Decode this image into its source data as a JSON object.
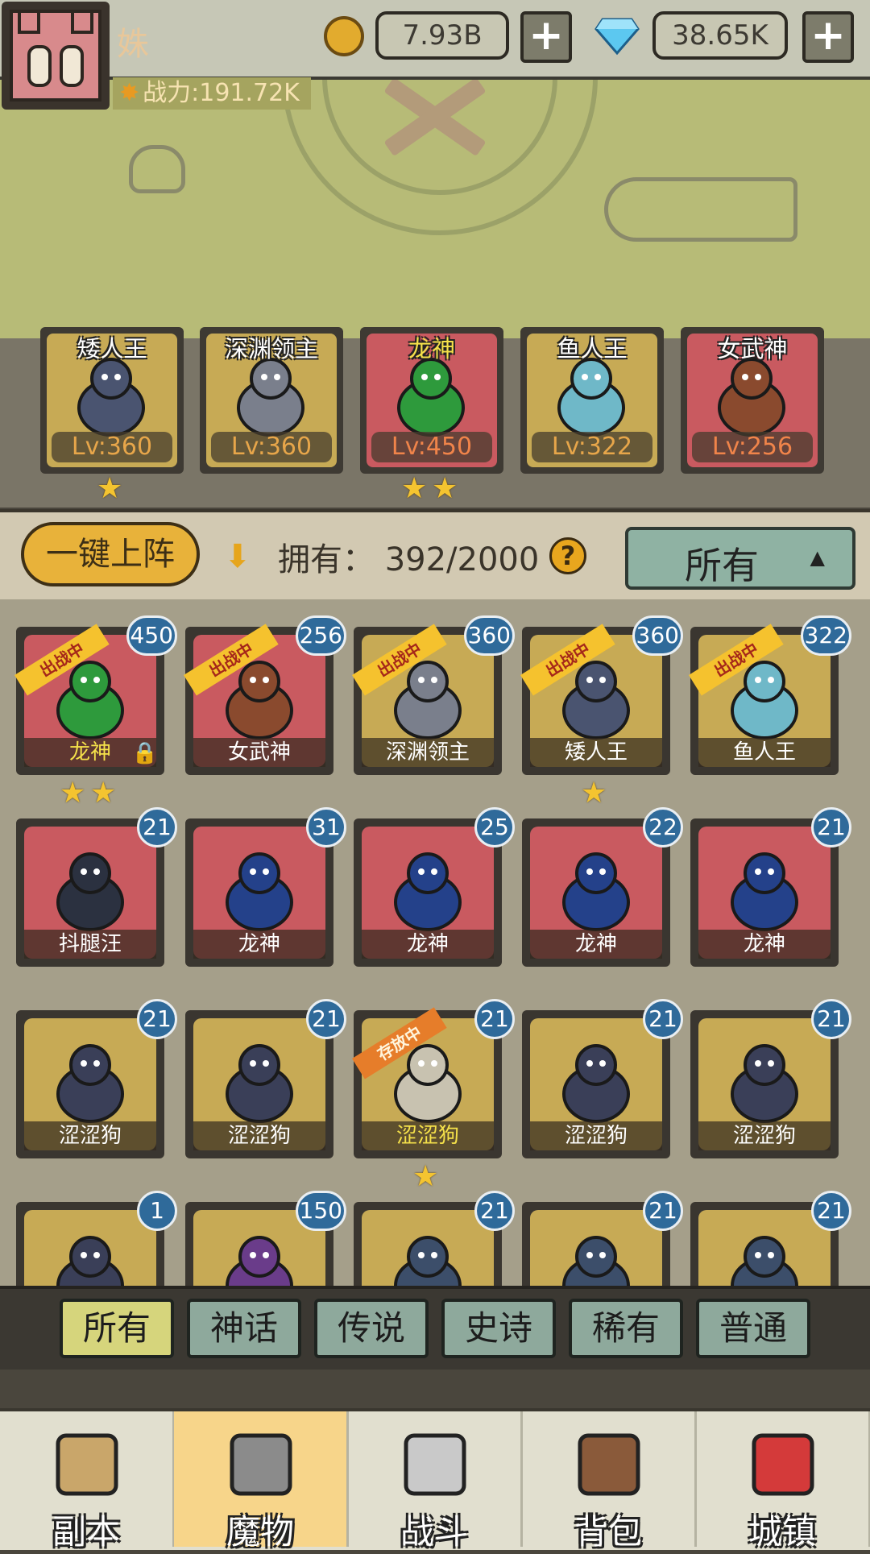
{
  "header": {
    "player_name": "姝",
    "gold": "7.93B",
    "gems": "38.65K",
    "power": "战力:191.72K",
    "plus": "+"
  },
  "formation": [
    {
      "name": "矮人王",
      "level": "Lv:360",
      "stars": 1,
      "bg": "#c7aa55",
      "name_color": "#ffffff",
      "lv_color": "#e7a64a"
    },
    {
      "name": "深渊领主",
      "level": "Lv:360",
      "stars": 0,
      "bg": "#c7aa55",
      "name_color": "#ffffff",
      "lv_color": "#e7a64a"
    },
    {
      "name": "龙神",
      "level": "Lv:450",
      "stars": 2,
      "bg": "#c95a60",
      "name_color": "#f5e14a",
      "lv_color": "#f0844a"
    },
    {
      "name": "鱼人王",
      "level": "Lv:322",
      "stars": 0,
      "bg": "#c7aa55",
      "name_color": "#ffffff",
      "lv_color": "#e7a64a"
    },
    {
      "name": "女武神",
      "level": "Lv:256",
      "stars": 0,
      "bg": "#c95a60",
      "name_color": "#ffffff",
      "lv_color": "#f0844a"
    }
  ],
  "actions": {
    "deploy_label": "一键上阵",
    "owned": "拥有： 392/2000",
    "help": "?",
    "sort_label": "所有"
  },
  "monsters": [
    [
      {
        "name": "龙神",
        "level": "450",
        "bg": "#c95a60",
        "tag": "出战中",
        "stars": 2,
        "lock": true,
        "name_color": "#f5e14a",
        "kind": "dragon-green"
      },
      {
        "name": "女武神",
        "level": "256",
        "bg": "#c95a60",
        "tag": "出战中",
        "stars": 0,
        "lock": false,
        "name_color": "#ffffff",
        "kind": "valkyrie"
      },
      {
        "name": "深渊领主",
        "level": "360",
        "bg": "#c7aa55",
        "tag": "出战中",
        "stars": 0,
        "lock": false,
        "name_color": "#ffffff",
        "kind": "abyss"
      },
      {
        "name": "矮人王",
        "level": "360",
        "bg": "#c7aa55",
        "tag": "出战中",
        "stars": 1,
        "lock": false,
        "name_color": "#ffffff",
        "kind": "dwarf"
      },
      {
        "name": "鱼人王",
        "level": "322",
        "bg": "#c7aa55",
        "tag": "出战中",
        "stars": 0,
        "lock": false,
        "name_color": "#ffffff",
        "kind": "fish"
      }
    ],
    [
      {
        "name": "抖腿汪",
        "level": "21",
        "bg": "#c95a60",
        "tag": "",
        "stars": 0,
        "lock": false,
        "name_color": "#ffffff",
        "kind": "wolf-dark"
      },
      {
        "name": "龙神",
        "level": "31",
        "bg": "#c95a60",
        "tag": "",
        "stars": 0,
        "lock": false,
        "name_color": "#ffffff",
        "kind": "dragon-blue"
      },
      {
        "name": "龙神",
        "level": "25",
        "bg": "#c95a60",
        "tag": "",
        "stars": 0,
        "lock": false,
        "name_color": "#ffffff",
        "kind": "dragon-blue"
      },
      {
        "name": "龙神",
        "level": "22",
        "bg": "#c95a60",
        "tag": "",
        "stars": 0,
        "lock": false,
        "name_color": "#ffffff",
        "kind": "dragon-blue"
      },
      {
        "name": "龙神",
        "level": "21",
        "bg": "#c95a60",
        "tag": "",
        "stars": 0,
        "lock": false,
        "name_color": "#ffffff",
        "kind": "dragon-blue"
      }
    ],
    [
      {
        "name": "涩涩狗",
        "level": "21",
        "bg": "#c7aa55",
        "tag": "",
        "stars": 0,
        "lock": false,
        "name_color": "#ffffff",
        "kind": "wolf"
      },
      {
        "name": "涩涩狗",
        "level": "21",
        "bg": "#c7aa55",
        "tag": "",
        "stars": 0,
        "lock": false,
        "name_color": "#ffffff",
        "kind": "wolf"
      },
      {
        "name": "涩涩狗",
        "level": "21",
        "bg": "#c7aa55",
        "tag": "存放中",
        "stars": 1,
        "lock": false,
        "name_color": "#f5e14a",
        "kind": "wolf-light"
      },
      {
        "name": "涩涩狗",
        "level": "21",
        "bg": "#c7aa55",
        "tag": "",
        "stars": 0,
        "lock": false,
        "name_color": "#ffffff",
        "kind": "wolf"
      },
      {
        "name": "涩涩狗",
        "level": "21",
        "bg": "#c7aa55",
        "tag": "",
        "stars": 0,
        "lock": false,
        "name_color": "#ffffff",
        "kind": "wolf"
      }
    ],
    [
      {
        "name": "",
        "level": "1",
        "bg": "#c7aa55",
        "tag": "",
        "stars": 0,
        "lock": false,
        "name_color": "#ffffff",
        "kind": "wolf"
      },
      {
        "name": "",
        "level": "150",
        "bg": "#c7aa55",
        "tag": "",
        "stars": 0,
        "lock": false,
        "name_color": "#ffffff",
        "kind": "mage-purple"
      },
      {
        "name": "",
        "level": "21",
        "bg": "#c7aa55",
        "tag": "",
        "stars": 0,
        "lock": false,
        "name_color": "#ffffff",
        "kind": "mage-blue"
      },
      {
        "name": "",
        "level": "21",
        "bg": "#c7aa55",
        "tag": "",
        "stars": 0,
        "lock": false,
        "name_color": "#ffffff",
        "kind": "mage-blue"
      },
      {
        "name": "",
        "level": "21",
        "bg": "#c7aa55",
        "tag": "",
        "stars": 0,
        "lock": false,
        "name_color": "#ffffff",
        "kind": "mage-blue"
      }
    ]
  ],
  "filters": [
    {
      "label": "所有",
      "selected": true
    },
    {
      "label": "神话",
      "selected": false
    },
    {
      "label": "传说",
      "selected": false
    },
    {
      "label": "史诗",
      "selected": false
    },
    {
      "label": "稀有",
      "selected": false
    },
    {
      "label": "普通",
      "selected": false
    }
  ],
  "nav": [
    {
      "label": "副本",
      "icon": "map-compass-icon",
      "selected": false
    },
    {
      "label": "魔物",
      "icon": "helmet-icon",
      "selected": true
    },
    {
      "label": "战斗",
      "icon": "crossed-swords-icon",
      "selected": false
    },
    {
      "label": "背包",
      "icon": "backpack-icon",
      "selected": false
    },
    {
      "label": "城镇",
      "icon": "shop-icon",
      "selected": false
    }
  ]
}
